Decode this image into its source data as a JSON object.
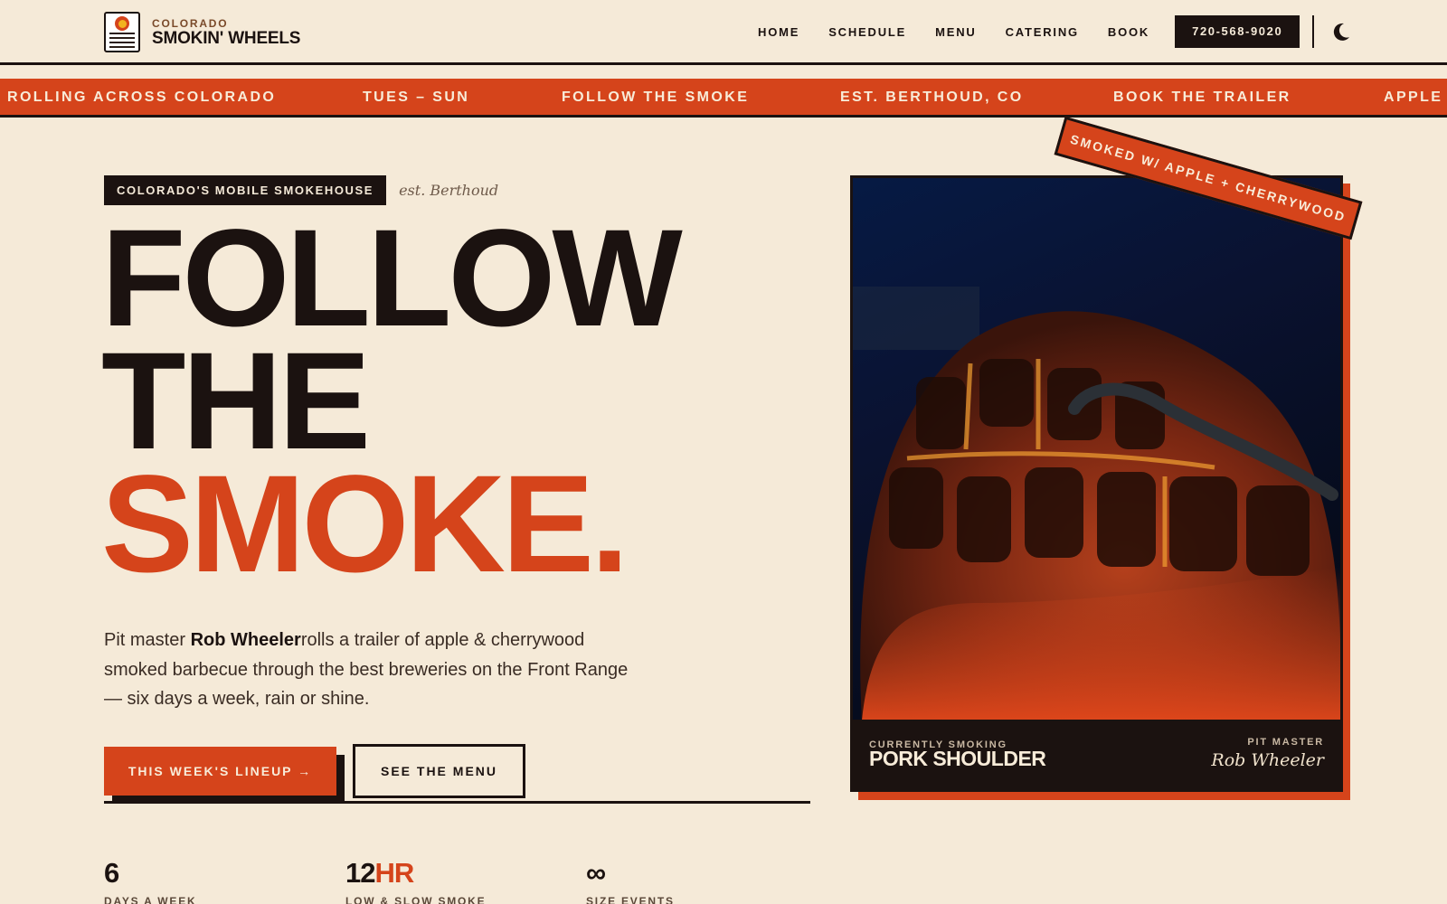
{
  "brand": {
    "sup": "COLORADO",
    "name": "SMOKIN' WHEELS"
  },
  "nav": {
    "links": [
      "HOME",
      "SCHEDULE",
      "MENU",
      "CATERING",
      "BOOK"
    ],
    "phone": "720-568-9020",
    "theme_icon": "moon-icon"
  },
  "ticker": {
    "items": [
      "ROLLING ACROSS COLORADO",
      "TUES – SUN",
      "FOLLOW THE SMOKE",
      "EST. BERTHOUD, CO",
      "BOOK THE TRAILER",
      "APPLE +"
    ]
  },
  "hero": {
    "badge": "COLORADO'S MOBILE SMOKEHOUSE",
    "est": "est. Berthoud",
    "headline": [
      "FOLLOW",
      "THE",
      "SMOKE."
    ],
    "lede": {
      "pre": "Pit master ",
      "name": "Rob Wheeler",
      "post": "rolls a trailer of apple & cherrywood smoked barbecue through the best breweries on the Front Range — six days a week, rain or shine."
    },
    "cta_primary": "THIS WEEK'S LINEUP →",
    "cta_secondary": "SEE THE MENU"
  },
  "stats": [
    {
      "num": "6",
      "accent": "",
      "label": "DAYS A WEEK"
    },
    {
      "num": "12",
      "accent": "HR",
      "label": "LOW & SLOW SMOKE"
    },
    {
      "num": "∞",
      "accent": "",
      "label": "SIZE EVENTS"
    }
  ],
  "card": {
    "stamp": "SMOKED W/ APPLE + CHERRYWOOD",
    "currently_label": "CURRENTLY SMOKING",
    "currently_title": "PORK SHOULDER",
    "pitmaster_label": "PIT MASTER",
    "pitmaster_name": "Rob Wheeler"
  },
  "colors": {
    "bg": "#f5ead8",
    "ink": "#1b1210",
    "accent": "#d5441b"
  }
}
